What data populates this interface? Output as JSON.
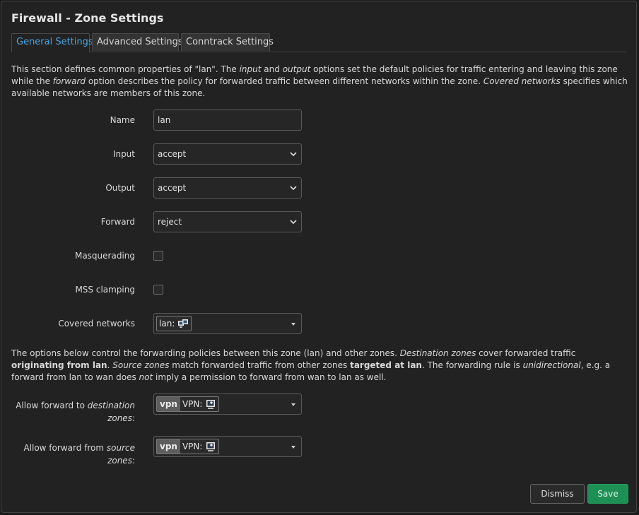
{
  "dialog": {
    "title": "Firewall - Zone Settings",
    "tabs": [
      {
        "label": "General Settings",
        "active": true
      },
      {
        "label": "Advanced Settings",
        "active": false
      },
      {
        "label": "Conntrack Settings",
        "active": false
      }
    ]
  },
  "intro": {
    "p1": "This section defines common properties of \"lan\". The ",
    "em_input": "input",
    "p2": " and ",
    "em_output": "output",
    "p3": " options set the default policies for traffic entering and leaving this zone while the ",
    "em_forward": "forward",
    "p4": " option describes the policy for forwarded traffic between different networks within the zone. ",
    "em_covered": "Covered networks",
    "p5": " specifies which available networks are members of this zone."
  },
  "form": {
    "name": {
      "label": "Name",
      "value": "lan"
    },
    "input": {
      "label": "Input",
      "value": "accept"
    },
    "output": {
      "label": "Output",
      "value": "accept"
    },
    "forward": {
      "label": "Forward",
      "value": "reject"
    },
    "masquerading": {
      "label": "Masquerading",
      "checked": false
    },
    "mss_clamping": {
      "label": "MSS clamping",
      "checked": false
    },
    "covered_networks": {
      "label": "Covered networks",
      "value": "lan:"
    }
  },
  "forwarding_desc": {
    "t1": "The options below control the forwarding policies between this zone (lan) and other zones. ",
    "e1": "Destination zones",
    "t2": " cover forwarded traffic ",
    "b1": "originating from lan",
    "t3": ". ",
    "e2": "Source zones",
    "t4": " match forwarded traffic from other zones ",
    "b2": "targeted at lan",
    "t5": ". The forwarding rule is ",
    "e3": "unidirectional",
    "t6": ", e.g. a forward from lan to wan does ",
    "e4": "not",
    "t7": " imply a permission to forward from wan to lan as well."
  },
  "forward_dest": {
    "label_pre": "Allow forward to ",
    "label_em": "destination zones",
    "label_post": ":",
    "zone": "vpn",
    "network": "VPN:"
  },
  "forward_src": {
    "label_pre": "Allow forward from ",
    "label_em": "source zones",
    "label_post": ":",
    "zone": "vpn",
    "network": "VPN:"
  },
  "buttons": {
    "dismiss": "Dismiss",
    "save": "Save"
  },
  "colors": {
    "accent": "#4aa3df",
    "save": "#1e8f55",
    "background": "#222222"
  }
}
